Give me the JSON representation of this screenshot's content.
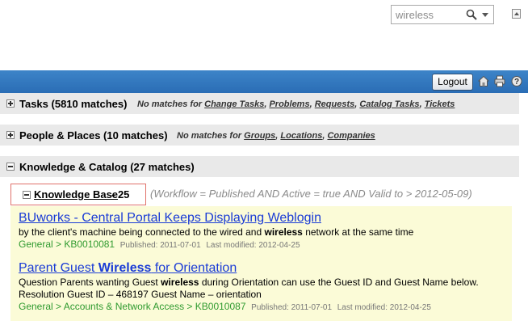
{
  "search": {
    "value": "wireless"
  },
  "header": {
    "logout_label": "Logout"
  },
  "sections": [
    {
      "title": "Tasks (5810 matches)",
      "nomatch_prefix": "No matches for ",
      "links": [
        "Change Tasks",
        "Problems",
        "Requests",
        "Catalog Tasks",
        "Tickets"
      ]
    },
    {
      "title": "People & Places (10 matches)",
      "nomatch_prefix": "No matches for ",
      "links": [
        "Groups",
        "Locations",
        "Companies"
      ]
    },
    {
      "title": "Knowledge & Catalog (27 matches)"
    }
  ],
  "separator": ", ",
  "knowledge_base": {
    "label": "Knowledge Base",
    "count": "- 25",
    "query": "(Workflow = Published AND Active = true AND Valid to > 2012-05-09)"
  },
  "results": [
    {
      "title": "BUworks - Central Portal Keeps Displaying Weblogin",
      "snippet_before": "by the client's machine being connected to the wired and ",
      "snippet_bold": "wireless",
      "snippet_after": " network at the same time",
      "crumb": "General > KB0010081",
      "published": "Published: 2011-07-01",
      "modified": "Last modified: 2012-04-25"
    },
    {
      "title_before": "Parent Guest ",
      "title_bold": "Wireless",
      "title_after": " for Orientation",
      "snippet_before": "Question Parents wanting Guest ",
      "snippet_bold": "wireless",
      "snippet_after": " during Orientation can use the Guest ID and Guest Name below. Resolution Guest ID – 468197 Guest Name – orientation",
      "crumb": "General > Accounts & Network Access > KB0010087",
      "published": "Published: 2011-07-01",
      "modified": "Last modified: 2012-04-25"
    }
  ]
}
